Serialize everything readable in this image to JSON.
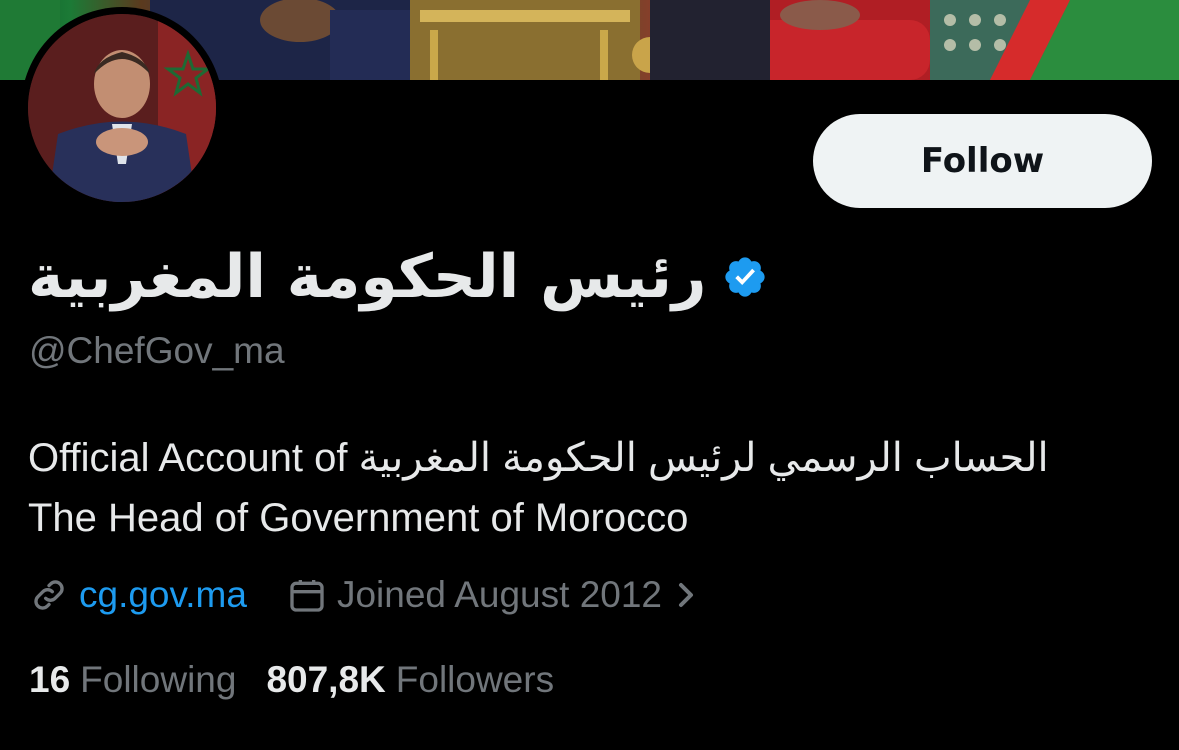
{
  "profile": {
    "display_name": "رئيس الحكومة المغربية",
    "handle": "@ChefGov_ma",
    "verified": true,
    "bio_line_1": "Official Account of الحساب الرسمي لرئيس الحكومة المغربية",
    "bio_line_2": "The Head of Government of Morocco",
    "website": "cg.gov.ma",
    "joined": "Joined August 2012",
    "following_count": "16",
    "following_label": "Following",
    "followers_count": "807,8K",
    "followers_label": "Followers"
  },
  "actions": {
    "follow_label": "Follow"
  },
  "icons": {
    "verified": "verified-badge-icon",
    "link": "link-icon",
    "calendar": "calendar-icon",
    "chevron": "chevron-right-icon"
  },
  "colors": {
    "background": "#000000",
    "primary_text": "#e7e9ea",
    "secondary_text": "#71767b",
    "link": "#1d9bf0",
    "button_bg": "#eff3f4",
    "button_text": "#0f1419"
  }
}
